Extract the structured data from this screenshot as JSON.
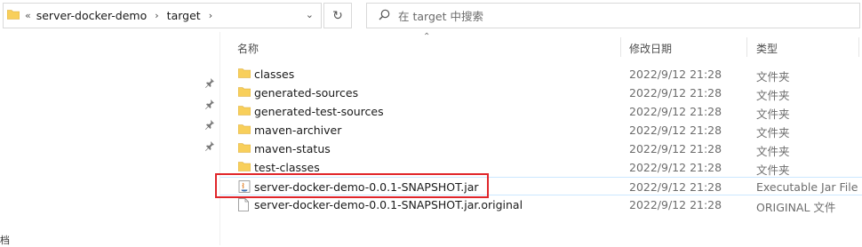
{
  "address_bar": {
    "overflow": "«",
    "crumbs": [
      "server-docker-demo",
      "target"
    ]
  },
  "search": {
    "placeholder": "在 target 中搜索"
  },
  "columns": {
    "name": "名称",
    "date": "修改日期",
    "type": "类型"
  },
  "nav_bottom_text": "档",
  "files": [
    {
      "name": "classes",
      "date": "2022/9/12 21:28",
      "type": "文件夹",
      "kind": "folder"
    },
    {
      "name": "generated-sources",
      "date": "2022/9/12 21:28",
      "type": "文件夹",
      "kind": "folder"
    },
    {
      "name": "generated-test-sources",
      "date": "2022/9/12 21:28",
      "type": "文件夹",
      "kind": "folder"
    },
    {
      "name": "maven-archiver",
      "date": "2022/9/12 21:28",
      "type": "文件夹",
      "kind": "folder"
    },
    {
      "name": "maven-status",
      "date": "2022/9/12 21:28",
      "type": "文件夹",
      "kind": "folder"
    },
    {
      "name": "test-classes",
      "date": "2022/9/12 21:28",
      "type": "文件夹",
      "kind": "folder"
    },
    {
      "name": "server-docker-demo-0.0.1-SNAPSHOT.jar",
      "date": "2022/9/12 21:28",
      "type": "Executable Jar File",
      "kind": "jar"
    },
    {
      "name": "server-docker-demo-0.0.1-SNAPSHOT.jar.original",
      "date": "2022/9/12 21:28",
      "type": "ORIGINAL 文件",
      "kind": "file"
    }
  ],
  "colors": {
    "folder": "#f8cf5b",
    "highlight": "#e0262b",
    "selection_border": "#cce8ff"
  }
}
